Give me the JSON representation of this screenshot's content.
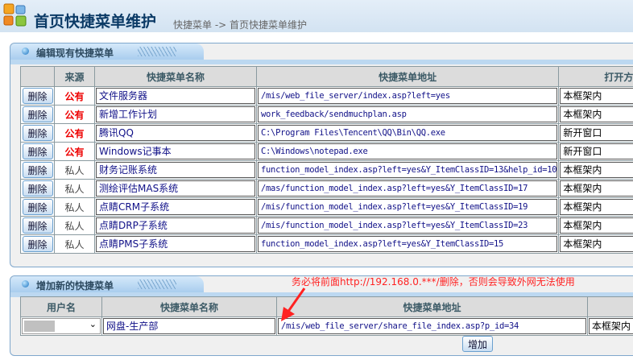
{
  "header": {
    "title": "首页快捷菜单维护",
    "breadcrumb": "快捷菜单  -> 首页快捷菜单维护"
  },
  "edit_panel": {
    "title": "编辑现有快捷菜单",
    "columns": [
      "",
      "来源",
      "快捷菜单名称",
      "快捷菜单地址",
      "打开方"
    ],
    "delete_label": "删除",
    "rows": [
      {
        "source": "公有",
        "public": true,
        "name": "文件服务器",
        "url": "/mis/web_file_server/index.asp?left=yes",
        "mode": "本框架内"
      },
      {
        "source": "公有",
        "public": true,
        "name": "新增工作计划",
        "url": "work_feedback/sendmuchplan.asp",
        "mode": "本框架内"
      },
      {
        "source": "公有",
        "public": true,
        "name": "腾讯QQ",
        "url": "C:\\Program Files\\Tencent\\QQ\\Bin\\QQ.exe",
        "mode": "新开窗口"
      },
      {
        "source": "公有",
        "public": true,
        "name": "Windows记事本",
        "url": "C:\\Windows\\notepad.exe",
        "mode": "新开窗口"
      },
      {
        "source": "私人",
        "public": false,
        "name": "财务记账系统",
        "url": "function_model_index.asp?left=yes&Y_ItemClassID=13&help_id=10",
        "mode": "本框架内"
      },
      {
        "source": "私人",
        "public": false,
        "name": "测绘评估MAS系统",
        "url": "/mas/function_model_index.asp?left=yes&Y_ItemClassID=17",
        "mode": "本框架内"
      },
      {
        "source": "私人",
        "public": false,
        "name": "点睛CRM子系统",
        "url": "/mis/function_model_index.asp?left=yes&Y_ItemClassID=19",
        "mode": "本框架内"
      },
      {
        "source": "私人",
        "public": false,
        "name": "点睛DRP子系统",
        "url": "/mis/function_model_index.asp?left=yes&Y_ItemClassID=23",
        "mode": "本框架内"
      },
      {
        "source": "私人",
        "public": false,
        "name": "点睛PMS子系统",
        "url": "function_model_index.asp?left=yes&Y_ItemClassID=15",
        "mode": "本框架内"
      }
    ]
  },
  "add_panel": {
    "title": "增加新的快捷菜单",
    "columns": [
      "用户名",
      "快捷菜单名称",
      "快捷菜单地址",
      ""
    ],
    "name_value": "网盘-生产部",
    "url_value": "/mis/web_file_server/share_file_index.asp?p_id=34",
    "mode_value": "本框架内",
    "add_label": "增加",
    "note": "务必将前面http://192.168.0.***/删除，否则会导致外网无法使用"
  }
}
